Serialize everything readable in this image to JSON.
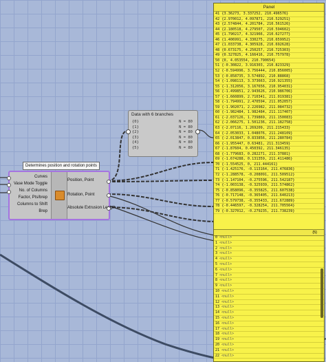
{
  "panel": {
    "title": "Panel",
    "rows": [
      "41 {3.36273, 3.337252, 210.496576}",
      "42 {2.970012, 4.097871, 210.529251}",
      "43 {2.574844, 4.201784, 210.561526}",
      "44 {2.180518, 4.279507, 210.594602}",
      "45 {1.790217, 4.321966, 210.627277}",
      "46 {1.406991, 4.330275, 210.659952}",
      "47 {1.033738, 4.305928, 210.692628}",
      "48 {0.673175, 4.250257, 210.725303}",
      "49 {0.327825, 4.166416, 210.757978}",
      "50 {0, 4.053554, 210.790654}",
      "51 {-0.30822, 3.916303, 210.823329}",
      "52 {-0.594996, 3.756444, 210.856005}",
      "53 {-0.858735, 3.574892, 210.88868}",
      "54 {-1.098113, 3.373663, 210.921355}",
      "55 {-1.312056, 3.167656, 210.954031}",
      "56 {-1.499851, 2.943626, 210.986706}",
      "57 {-1.660899, 2.710341, 211.019381}",
      "58 {-1.794991, 2.470594, 211.052057}",
      "59 {-1.902071, 2.226982, 211.084732}",
      "60 {-1.982484, 1.982484, 211.117407}",
      "61 {-2.037126, 1.739869, 211.150083}",
      "62 {-2.066275, 1.501236, 211.182758}",
      "63 {-2.07116, 1.269209, 211.215433}",
      "64 {-2.053033, 1.048076, 211.248109}",
      "65 {-2.013847, 0.833856, 211.280784}",
      "66 {-1.955447, 0.63481, 211.313459}",
      "67 {-1.87604, 0.450392, 211.346135}",
      "68 {-1.779683, 0.282271, 211.37881}",
      "69 {-1.674288, 0.131359, 211.411486}",
      "70 {-1.554525, 0, 211.444161}",
      "71 {-1.425176, -0.113164, 211.476836}",
      "72 {-1.288578, -0.208091, 211.509512}",
      "73 {-1.147104, -0.275596, 211.542187}",
      "74 {-1.003138, -0.325939, 211.574862}",
      "75 {-0.858096, -0.355825, 211.607538}",
      "76 {-0.717148, -0.365405, 211.640213}",
      "77 {-0.579738, -0.355433, 211.672889}",
      "78 {-0.446597, -0.328254, 211.705564}",
      "79 {-0.327012, -0.279235, 211.738239}"
    ],
    "branch_label": "{5}",
    "null_rows": [
      {
        "index": "0",
        "value": "<null>"
      },
      {
        "index": "1",
        "value": "<null>"
      },
      {
        "index": "2",
        "value": "<null>"
      },
      {
        "index": "3",
        "value": "<null>"
      },
      {
        "index": "4",
        "value": "<null>"
      },
      {
        "index": "5",
        "value": "<null>"
      },
      {
        "index": "6",
        "value": "<null>"
      },
      {
        "index": "7",
        "value": "<null>"
      },
      {
        "index": "8",
        "value": "<null>"
      },
      {
        "index": "9",
        "value": "<null>"
      },
      {
        "index": "10",
        "value": "<null>"
      },
      {
        "index": "11",
        "value": "<null>"
      },
      {
        "index": "12",
        "value": "<null>"
      },
      {
        "index": "13",
        "value": "<null>"
      },
      {
        "index": "14",
        "value": "<null>"
      },
      {
        "index": "15",
        "value": "<null>"
      },
      {
        "index": "16",
        "value": "<null>"
      },
      {
        "index": "17",
        "value": "<null>"
      },
      {
        "index": "18",
        "value": "<null>"
      },
      {
        "index": "19",
        "value": "<null>"
      },
      {
        "index": "20",
        "value": "<null>"
      },
      {
        "index": "21",
        "value": "<null>"
      },
      {
        "index": "22",
        "value": "<null>"
      }
    ]
  },
  "data_node": {
    "title": "Data with 6 branches",
    "branches": [
      {
        "path": "{0}",
        "count": "N = 80"
      },
      {
        "path": "{1}",
        "count": "N = 80"
      },
      {
        "path": "{2}",
        "count": "N = 80"
      },
      {
        "path": "{3}",
        "count": "N = 80"
      },
      {
        "path": "{4}",
        "count": "N = 80"
      },
      {
        "path": "{5}",
        "count": "N = 80"
      }
    ]
  },
  "component": {
    "tooltip": "Determines position and rotation points",
    "inputs": [
      "Curves",
      "Vase Mode Toggle",
      "No. of Columns",
      "Factor, Pts/brep",
      "Columns to Shift",
      "Brep"
    ],
    "outputs": [
      "Position, Point",
      "Rotation, Point",
      "Absolute Extrusion Length"
    ]
  },
  "colors": {
    "canvas": "#a8b8d8",
    "panel": "#f8f24a",
    "selection": "#a574e0",
    "component_body": "#c6c6c6"
  }
}
